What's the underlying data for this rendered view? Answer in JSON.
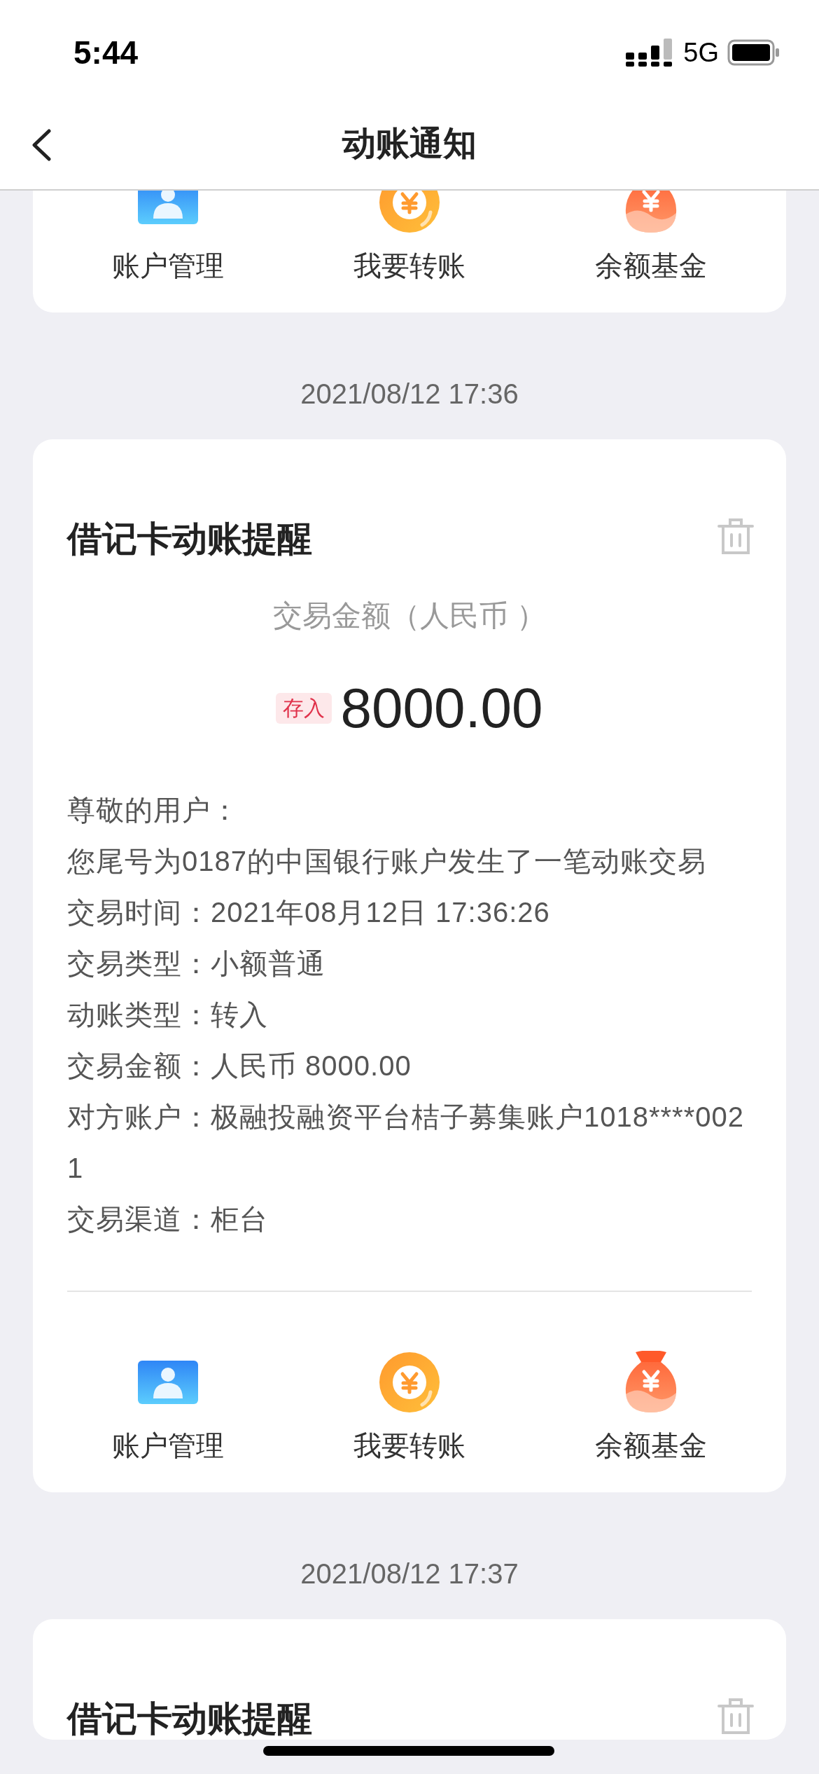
{
  "status_bar": {
    "time": "5:44",
    "network": "5G"
  },
  "nav": {
    "title": "动账通知"
  },
  "top_card": {
    "actions": [
      {
        "kind": "account",
        "label": "账户管理"
      },
      {
        "kind": "transfer",
        "label": "我要转账"
      },
      {
        "kind": "fund",
        "label": "余额基金"
      }
    ]
  },
  "messages": [
    {
      "timestamp": "2021/08/12 17:36",
      "card": {
        "title": "借记卡动账提醒",
        "subtitle": "交易金额（人民币 ）",
        "tag": "存入",
        "amount": "8000.00",
        "lines": [
          "尊敬的用户：",
          "您尾号为0187的中国银行账户发生了一笔动账交易",
          "交易时间：2021年08月12日 17:36:26",
          "交易类型：小额普通",
          "动账类型：转入",
          "交易金额：人民币 8000.00",
          "对方账户：极融投融资平台桔子募集账户1018****0021",
          "交易渠道：柜台"
        ],
        "actions": [
          {
            "kind": "account",
            "label": "账户管理"
          },
          {
            "kind": "transfer",
            "label": "我要转账"
          },
          {
            "kind": "fund",
            "label": "余额基金"
          }
        ]
      }
    },
    {
      "timestamp": "2021/08/12 17:37",
      "card": {
        "title": "借记卡动账提醒"
      }
    }
  ]
}
